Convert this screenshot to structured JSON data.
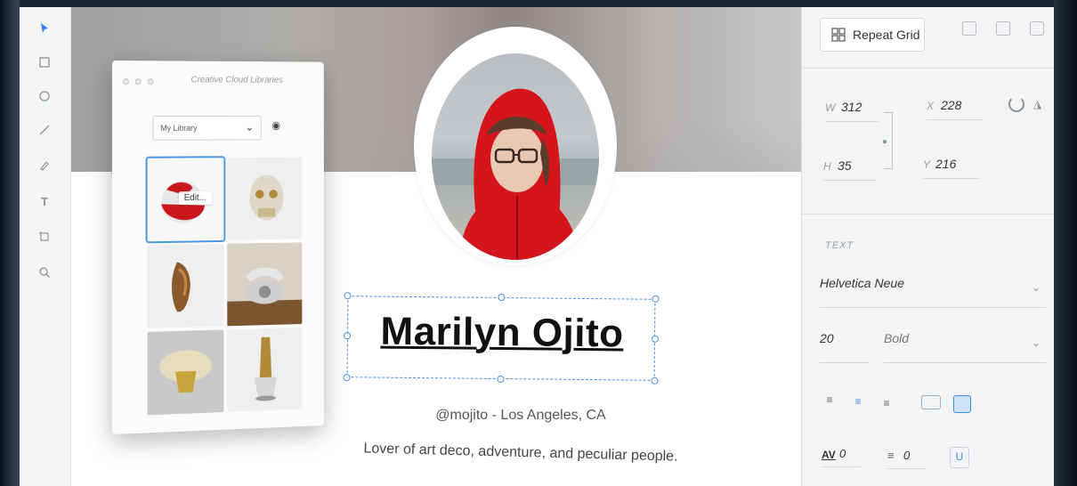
{
  "toolbar": {
    "tools": [
      "select-tool",
      "rectangle-tool",
      "ellipse-tool",
      "line-tool",
      "pen-tool",
      "text-tool",
      "artboard-tool",
      "zoom-tool"
    ]
  },
  "cc_libraries": {
    "title": "Creative Cloud Libraries",
    "library_select": "My Library",
    "edit_tooltip": "Edit..."
  },
  "profile": {
    "name": "Marilyn Ojito",
    "handle": "@mojito - Los Angeles, CA",
    "bio": "Lover of art deco, adventure, and peculiar people."
  },
  "inspector": {
    "repeat_grid_label": "Repeat Grid",
    "w_label": "W",
    "w_value": "312",
    "x_label": "X",
    "x_value": "228",
    "h_label": "H",
    "h_value": "35",
    "y_label": "Y",
    "y_value": "216",
    "text_section": "TEXT",
    "font_family": "Helvetica Neue",
    "font_size": "20",
    "font_weight": "Bold",
    "char_spacing_label": "AV",
    "char_spacing": "0",
    "line_spacing": "0"
  },
  "colors": {
    "selection": "#4a90d9",
    "accent": "#3d8de0",
    "hood_red": "#d4161c"
  }
}
